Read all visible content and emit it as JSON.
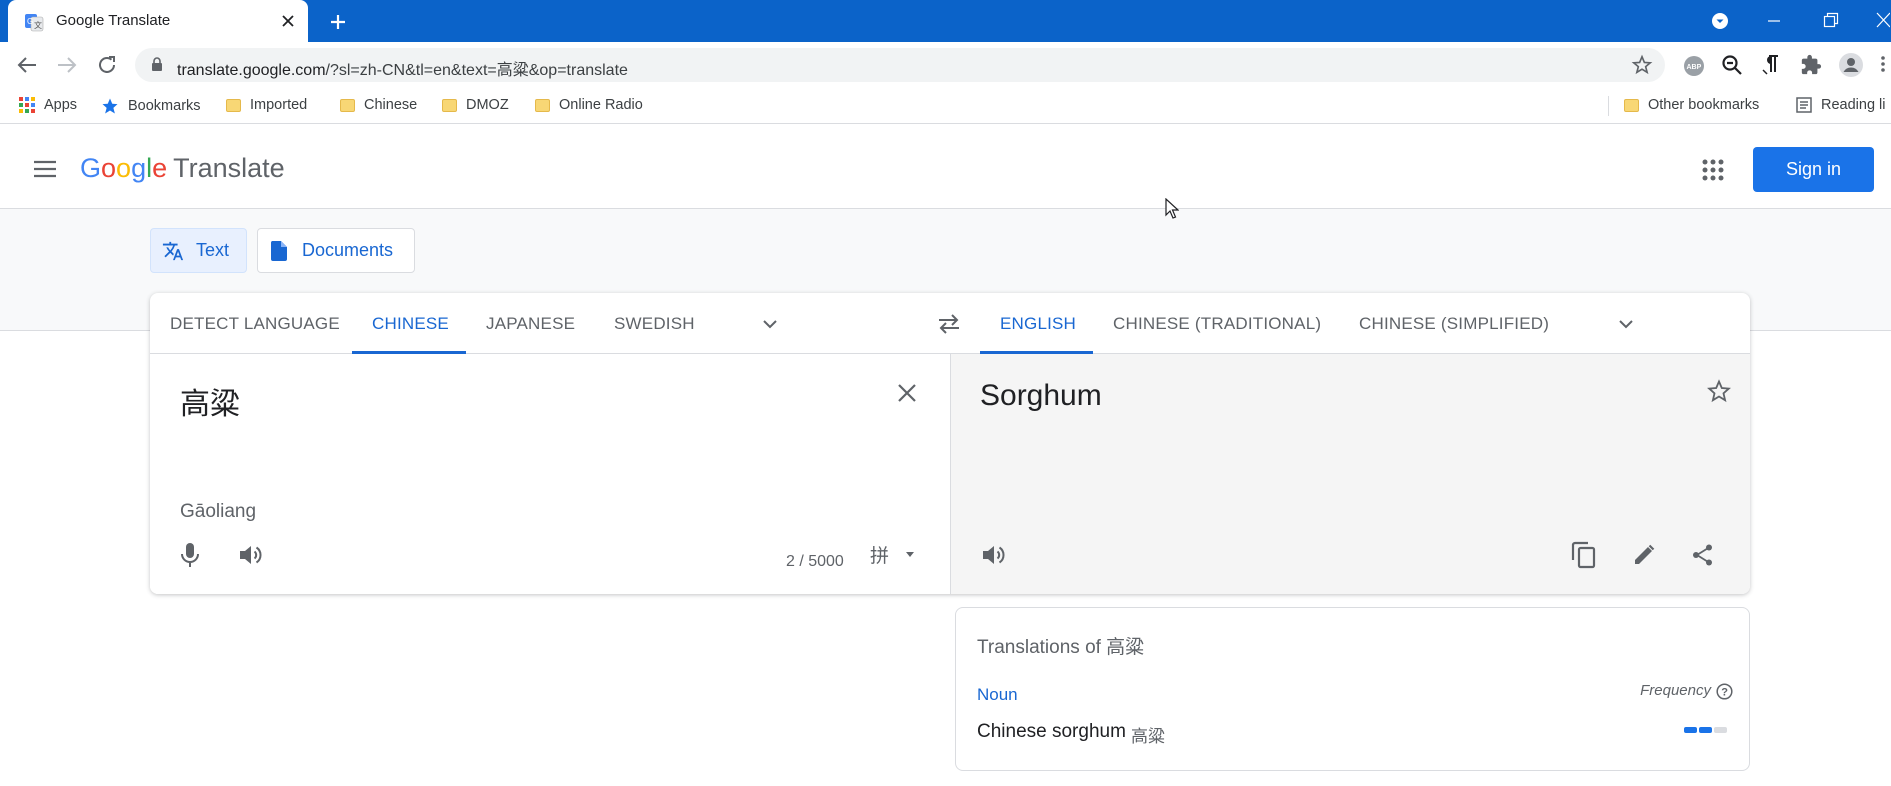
{
  "browser": {
    "tab_title": "Google Translate",
    "url_host": "translate.google.com",
    "url_path": "/?sl=zh-CN&tl=en&text=高粱&op=translate",
    "bookmarks": [
      "Apps",
      "Bookmarks",
      "Imported",
      "Chinese",
      "DMOZ",
      "Online Radio"
    ],
    "other_bookmarks": "Other bookmarks",
    "reading_list": "Reading li"
  },
  "header": {
    "logo_letters": [
      "G",
      "o",
      "o",
      "g",
      "l",
      "e"
    ],
    "product": "Translate",
    "signin_label": "Sign in"
  },
  "modes": {
    "text_label": "Text",
    "docs_label": "Documents"
  },
  "source_langs": [
    "DETECT LANGUAGE",
    "CHINESE",
    "JAPANESE",
    "SWEDISH"
  ],
  "target_langs": [
    "ENGLISH",
    "CHINESE (TRADITIONAL)",
    "CHINESE (SIMPLIFIED)"
  ],
  "source": {
    "text": "高粱",
    "transliteration": "Gāoliang",
    "char_count": "2 / 5000"
  },
  "target": {
    "text": "Sorghum"
  },
  "translations": {
    "header": "Translations of 高粱",
    "part_of_speech": "Noun",
    "frequency_label": "Frequency",
    "word": "Chinese sorghum",
    "synonym": "高粱",
    "frequency_level": 2,
    "frequency_max": 3
  },
  "colors": {
    "chrome_blue": "#0b63c9",
    "accent": "#1a73e8",
    "selected_lang": "#1967d2"
  }
}
